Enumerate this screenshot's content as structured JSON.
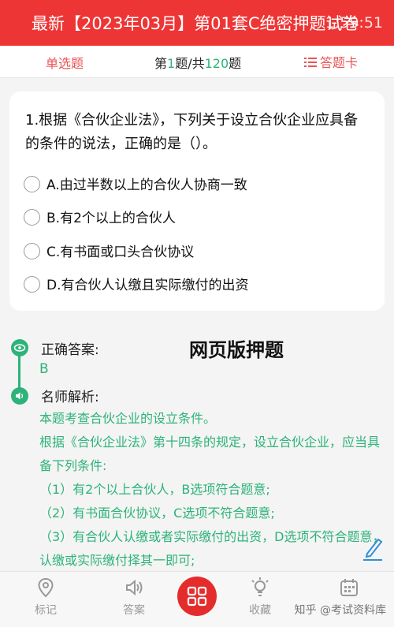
{
  "header": {
    "title": "最新【2023年03月】第01套C绝密押题试卷",
    "timer": "1:59:51"
  },
  "subbar": {
    "mode": "单选题",
    "progress_prefix": "第",
    "current": "1",
    "progress_mid": "题/共",
    "total": "120",
    "progress_suffix": "题",
    "card": "答题卡"
  },
  "question": {
    "text": "1.根据《合伙企业法》，下列关于设立合伙企业应具备的条件的说法，正确的是（）。",
    "options": [
      "A.由过半数以上的合伙人协商一致",
      "B.有2个以上的合伙人",
      "C.有书面或口头合伙协议",
      "D.有合伙人认缴且实际缴付的出资"
    ]
  },
  "answer": {
    "label": "正确答案:",
    "value": "B",
    "explain_label": "名师解析:",
    "watermark": "网页版押题",
    "lines": [
      "本题考查合伙企业的设立条件。",
      "根据《合伙企业法》第十四条的规定，设立合伙企业，应当具备下列条件:",
      "（1）有2个以上合伙人，B选项符合题意;",
      "（2）有书面合伙协议，C选项不符合题意;",
      "（3）有合伙人认缴或者实际缴付的出资，D选项不符合题意，认缴或实际缴付择其一即可;"
    ]
  },
  "bottom": {
    "tabs": [
      "标记",
      "答案",
      "收藏",
      ""
    ],
    "wm": "知乎 @考试资料库"
  },
  "colors": {
    "accent": "#ee3535",
    "green": "#2db37a"
  }
}
